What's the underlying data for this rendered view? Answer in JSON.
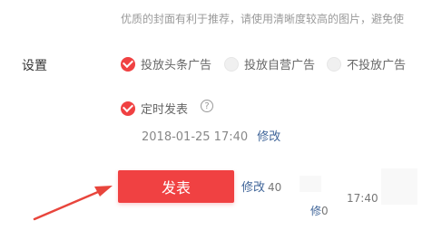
{
  "hint_text": "优质的封面有利于推荐，请使用清晰度较高的图片，避免使",
  "settings": {
    "label": "设置",
    "ad_options": [
      {
        "label": "投放头条广告",
        "selected": true
      },
      {
        "label": "投放自营广告",
        "selected": false
      },
      {
        "label": "不投放广告",
        "selected": false
      }
    ],
    "scheduled": {
      "label": "定时发表",
      "checked": true,
      "help_icon": "question-circle-icon",
      "datetime": "2018-01-25 17:40",
      "edit_label": "修改"
    }
  },
  "publish": {
    "button_label": "发表",
    "edit_label": "修改",
    "edit_suffix": "40",
    "ghost_time": "17:40",
    "ghost_edit": "修",
    "ghost_suffix": "0"
  },
  "colors": {
    "accent": "#f04142",
    "link": "#406599",
    "arrow": "#e8453c"
  }
}
